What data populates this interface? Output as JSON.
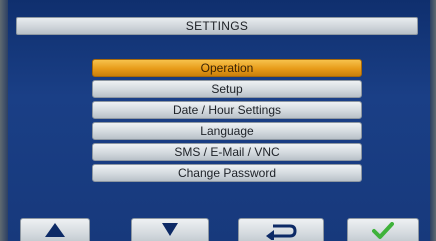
{
  "header": {
    "title": "SETTINGS"
  },
  "menu": {
    "selected_index": 0,
    "items": [
      {
        "label": "Operation"
      },
      {
        "label": "Setup"
      },
      {
        "label": "Date / Hour Settings"
      },
      {
        "label": "Language"
      },
      {
        "label": "SMS / E-Mail / VNC"
      },
      {
        "label": "Change Password"
      }
    ]
  },
  "nav": {
    "buttons": [
      {
        "icon": "arrow-up-icon"
      },
      {
        "icon": "arrow-down-icon"
      },
      {
        "icon": "return-arrow-icon"
      },
      {
        "icon": "checkmark-icon"
      }
    ]
  },
  "colors": {
    "background": "#1a3f86",
    "selected": "#e79b19",
    "button": "#d3d9de",
    "checkmark": "#3fb23a",
    "icon_dark": "#0d2a66"
  }
}
